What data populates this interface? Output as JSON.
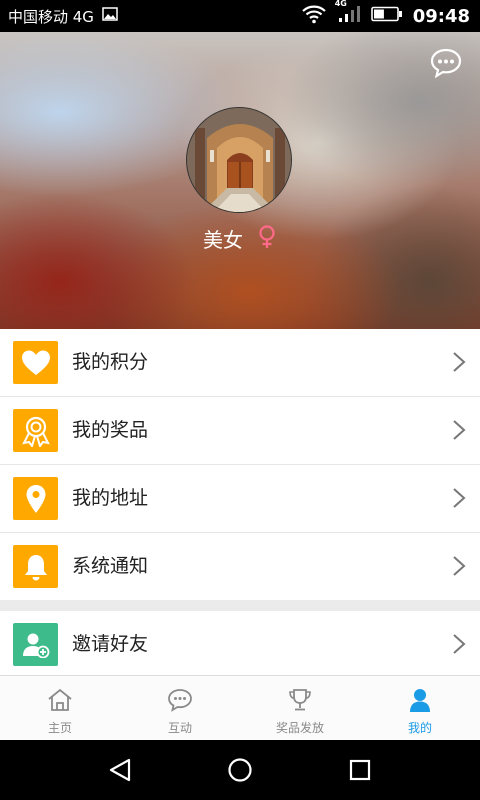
{
  "status_bar": {
    "carrier": "中国移动 4G",
    "network_badge": "4G",
    "time": "09:48",
    "icons": [
      "image-icon",
      "wifi-icon",
      "signal-icon",
      "battery-icon"
    ],
    "battery_level": 0.45
  },
  "profile": {
    "username": "美女",
    "gender_icon": "female-icon",
    "message_icon": "chat-bubble-icon"
  },
  "menu": {
    "items": [
      {
        "label": "我的积分",
        "icon": "heart-icon",
        "color": "#ffa800"
      },
      {
        "label": "我的奖品",
        "icon": "award-ribbon-icon",
        "color": "#ffa800"
      },
      {
        "label": "我的地址",
        "icon": "location-pin-icon",
        "color": "#ffa800"
      },
      {
        "label": "系统通知",
        "icon": "bell-icon",
        "color": "#ffa800"
      },
      {
        "label": "邀请好友",
        "icon": "add-user-icon",
        "color": "#3dbb8a"
      }
    ]
  },
  "tabbar": {
    "tabs": [
      {
        "label": "主页",
        "icon": "home-icon"
      },
      {
        "label": "互动",
        "icon": "chat-icon"
      },
      {
        "label": "奖品发放",
        "icon": "trophy-icon"
      },
      {
        "label": "我的",
        "icon": "user-icon",
        "active": true
      }
    ],
    "active_color": "#1a9be6"
  },
  "nav_bar": {
    "icons": [
      "back-icon",
      "home-circle-icon",
      "recents-icon"
    ]
  }
}
